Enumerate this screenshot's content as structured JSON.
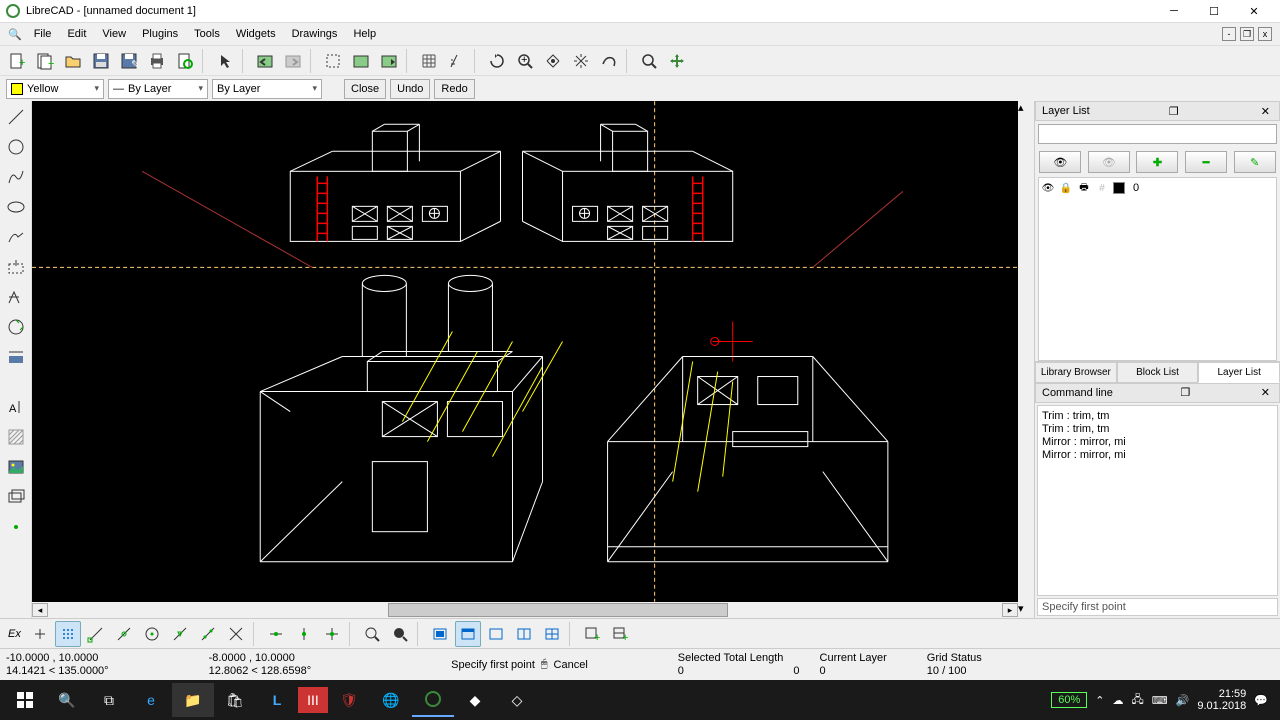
{
  "app": {
    "title": "LibreCAD - [unnamed document 1]"
  },
  "menu": [
    "File",
    "Edit",
    "View",
    "Plugins",
    "Tools",
    "Widgets",
    "Drawings",
    "Help"
  ],
  "props": {
    "color_label": "Yellow",
    "linetype": "By Layer",
    "lineweight": "By Layer",
    "close": "Close",
    "undo": "Undo",
    "redo": "Redo"
  },
  "layerpanel": {
    "title": "Layer List",
    "layer0": "0",
    "tabs": [
      "Library Browser",
      "Block List",
      "Layer List"
    ]
  },
  "cmd": {
    "title": "Command line",
    "history": [
      "Trim : trim, tm",
      "Trim : trim, tm",
      "Mirror : mirror, mi",
      "Mirror : mirror, mi"
    ],
    "prompt": "Specify first point"
  },
  "bottom": {
    "ex": "Ex"
  },
  "status": {
    "coord1a": "-10.0000 , 10.0000",
    "coord1b": "14.1421 < 135.0000°",
    "coord2a": "-8.0000 , 10.0000",
    "coord2b": "12.8062 < 128.6598°",
    "prompt": "Specify first point",
    "cancel": "Cancel",
    "sel_h": "Selected Total Length",
    "sel_v": "0",
    "t2": "0",
    "layer_h": "Current Layer",
    "layer_v": "0",
    "grid_h": "Grid Status",
    "grid_v": "10 / 100"
  },
  "taskbar": {
    "battery": "60%",
    "time": "21:59",
    "date": "9.01.2018"
  }
}
